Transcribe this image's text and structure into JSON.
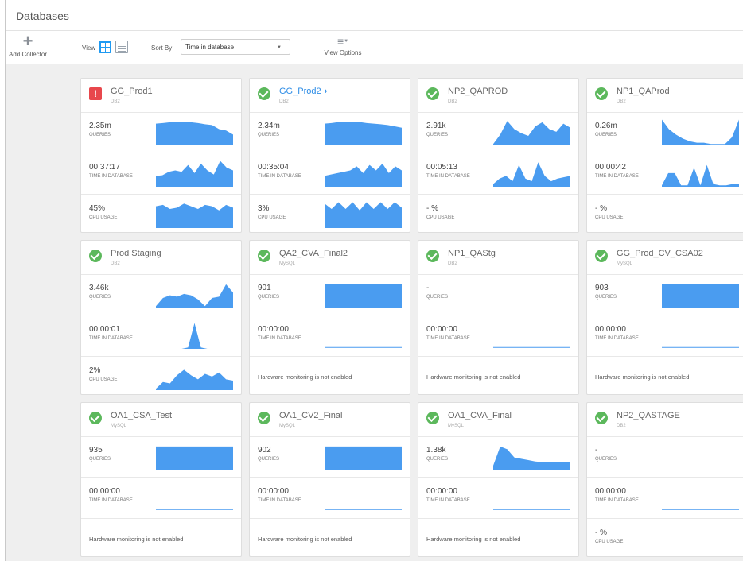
{
  "page": {
    "title": "Databases"
  },
  "toolbar": {
    "add_collector_label": "Add Collector",
    "view_label": "View",
    "sort_by_label": "Sort By",
    "sort_value": "Time in database",
    "view_options_label": "View Options"
  },
  "colors": {
    "accent": "#1f9af2",
    "chart_fill": "#4a9cf0",
    "ok": "#5cb85c",
    "error": "#e8474c"
  },
  "metric_labels": {
    "queries": "QUERIES",
    "time": "TIME IN DATABASE",
    "cpu": "CPU USAGE"
  },
  "hw_message": "Hardware monitoring is not enabled",
  "cards": [
    {
      "name": "GG_Prod1",
      "type": "DB2",
      "status": "error",
      "queries": "2.35m",
      "time": "00:37:17",
      "cpu": "45%",
      "q_spark": [
        0.8,
        0.82,
        0.85,
        0.88,
        0.88,
        0.85,
        0.82,
        0.78,
        0.75,
        0.6,
        0.55,
        0.4
      ],
      "t_spark": [
        0.4,
        0.42,
        0.55,
        0.6,
        0.55,
        0.8,
        0.5,
        0.85,
        0.6,
        0.45,
        0.95,
        0.7,
        0.6
      ],
      "c_spark": [
        0.8,
        0.85,
        0.7,
        0.75,
        0.9,
        0.8,
        0.7,
        0.85,
        0.8,
        0.65,
        0.85,
        0.75
      ]
    },
    {
      "name": "GG_Prod2",
      "type": "DB2",
      "status": "ok",
      "link": true,
      "queries": "2.34m",
      "time": "00:35:04",
      "cpu": "3%",
      "q_spark": [
        0.8,
        0.82,
        0.86,
        0.88,
        0.88,
        0.86,
        0.82,
        0.8,
        0.78,
        0.75,
        0.7,
        0.65
      ],
      "t_spark": [
        0.4,
        0.45,
        0.5,
        0.55,
        0.6,
        0.75,
        0.5,
        0.8,
        0.6,
        0.85,
        0.5,
        0.75,
        0.6
      ],
      "c_spark": [
        0.9,
        0.7,
        0.95,
        0.7,
        0.95,
        0.65,
        0.95,
        0.7,
        0.95,
        0.7,
        0.95,
        0.75
      ]
    },
    {
      "name": "NP2_QAPROD",
      "type": "DB2",
      "status": "ok",
      "queries": "2.91k",
      "time": "00:05:13",
      "cpu": "- %",
      "q_spark": [
        0.05,
        0.4,
        0.9,
        0.6,
        0.45,
        0.35,
        0.7,
        0.85,
        0.6,
        0.5,
        0.8,
        0.65
      ],
      "t_spark": [
        0.1,
        0.3,
        0.4,
        0.2,
        0.8,
        0.3,
        0.2,
        0.9,
        0.4,
        0.2,
        0.3,
        0.35,
        0.4
      ],
      "c_spark": null
    },
    {
      "name": "NP1_QAProd",
      "type": "DB2",
      "status": "ok",
      "queries": "0.26m",
      "time": "00:00:42",
      "cpu": "- %",
      "q_spark": [
        0.95,
        0.6,
        0.4,
        0.25,
        0.15,
        0.1,
        0.1,
        0.05,
        0.05,
        0.05,
        0.3,
        0.95
      ],
      "t_spark": [
        0.05,
        0.5,
        0.5,
        0.05,
        0.05,
        0.7,
        0.05,
        0.8,
        0.1,
        0.05,
        0.05,
        0.1,
        0.1
      ],
      "c_spark": null
    },
    {
      "name": "Prod Staging",
      "type": "DB2",
      "status": "ok",
      "queries": "3.46k",
      "time": "00:00:01",
      "cpu": "2%",
      "q_spark": [
        0.05,
        0.35,
        0.45,
        0.4,
        0.5,
        0.45,
        0.3,
        0.05,
        0.35,
        0.4,
        0.85,
        0.55
      ],
      "t_spark": [
        0,
        0,
        0,
        0,
        0,
        0.05,
        0.95,
        0.05,
        0,
        0,
        0,
        0,
        0
      ],
      "c_spark": [
        0.05,
        0.3,
        0.25,
        0.55,
        0.75,
        0.55,
        0.4,
        0.6,
        0.5,
        0.65,
        0.4,
        0.35
      ]
    },
    {
      "name": "QA2_CVA_Final2",
      "type": "MySQL",
      "status": "ok",
      "queries": "901",
      "time": "00:00:00",
      "cpu": null,
      "q_spark": [
        0.85,
        0.85,
        0.85,
        0.85,
        0.85,
        0.85,
        0.85,
        0.85,
        0.85,
        0.85,
        0.85,
        0.85
      ],
      "t_spark": [
        0,
        0,
        0,
        0,
        0,
        0,
        0,
        0,
        0,
        0,
        0,
        0,
        0
      ],
      "c_spark": null
    },
    {
      "name": "NP1_QAStg",
      "type": "DB2",
      "status": "ok",
      "queries": "-",
      "time": "00:00:00",
      "cpu": null,
      "q_spark": null,
      "t_spark": [
        0,
        0,
        0,
        0,
        0,
        0,
        0,
        0,
        0,
        0,
        0,
        0,
        0
      ],
      "c_spark": null
    },
    {
      "name": "GG_Prod_CV_CSA02",
      "type": "MySQL",
      "status": "ok",
      "queries": "903",
      "time": "00:00:00",
      "cpu": null,
      "q_spark": [
        0.85,
        0.85,
        0.85,
        0.85,
        0.85,
        0.85,
        0.85,
        0.85,
        0.85,
        0.85,
        0.85,
        0.85
      ],
      "t_spark": [
        0,
        0,
        0,
        0,
        0,
        0,
        0,
        0,
        0,
        0,
        0,
        0,
        0
      ],
      "c_spark": null
    },
    {
      "name": "OA1_CSA_Test",
      "type": "MySQL",
      "status": "ok",
      "queries": "935",
      "time": "00:00:00",
      "cpu": null,
      "q_spark": [
        0.85,
        0.85,
        0.85,
        0.85,
        0.85,
        0.85,
        0.85,
        0.85,
        0.85,
        0.85,
        0.85,
        0.85
      ],
      "t_spark": [
        0,
        0,
        0,
        0,
        0,
        0,
        0,
        0,
        0,
        0,
        0,
        0,
        0
      ],
      "c_spark": null
    },
    {
      "name": "OA1_CV2_Final",
      "type": "MySQL",
      "status": "ok",
      "queries": "902",
      "time": "00:00:00",
      "cpu": null,
      "q_spark": [
        0.85,
        0.85,
        0.85,
        0.85,
        0.85,
        0.85,
        0.85,
        0.85,
        0.85,
        0.85,
        0.85,
        0.85
      ],
      "t_spark": [
        0,
        0,
        0,
        0,
        0,
        0,
        0,
        0,
        0,
        0,
        0,
        0,
        0
      ],
      "c_spark": null
    },
    {
      "name": "OA1_CVA_Final",
      "type": "MySQL",
      "status": "ok",
      "queries": "1.38k",
      "time": "00:00:00",
      "cpu": null,
      "q_spark": [
        0.15,
        0.85,
        0.75,
        0.45,
        0.4,
        0.35,
        0.3,
        0.28,
        0.28,
        0.28,
        0.28,
        0.28
      ],
      "t_spark": [
        0,
        0,
        0,
        0,
        0,
        0,
        0,
        0,
        0,
        0,
        0,
        0,
        0
      ],
      "c_spark": null
    },
    {
      "name": "NP2_QASTAGE",
      "type": "DB2",
      "status": "ok",
      "queries": "-",
      "time": "00:00:00",
      "cpu": "- %",
      "cpu_shown": true,
      "q_spark": null,
      "t_spark": [
        0,
        0,
        0,
        0,
        0,
        0,
        0,
        0,
        0,
        0,
        0,
        0,
        0
      ],
      "c_spark": null
    }
  ]
}
